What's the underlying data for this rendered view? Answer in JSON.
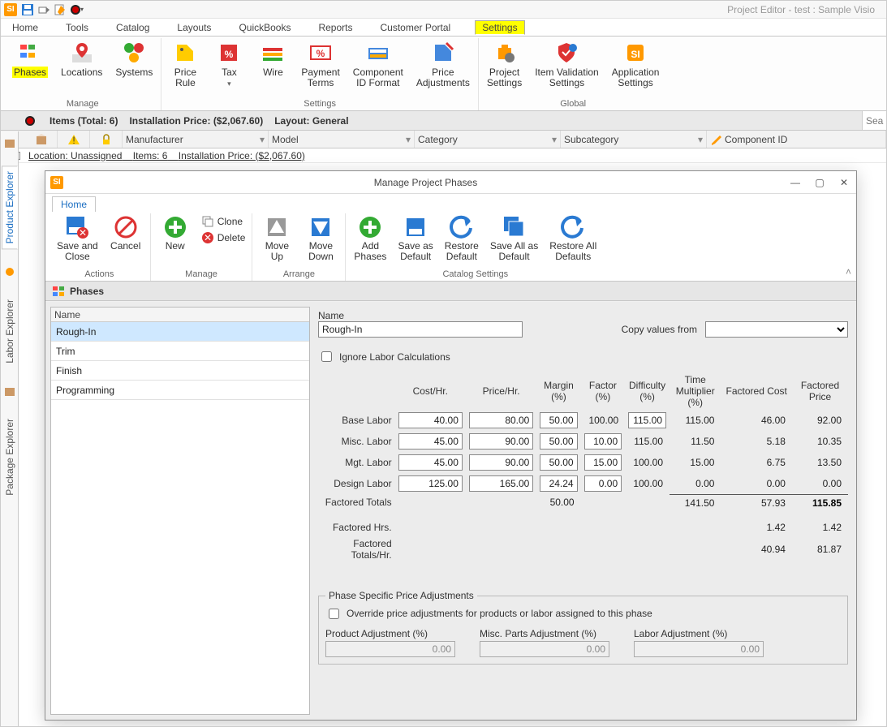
{
  "app_title": "Project Editor - test : Sample Visio",
  "menu_tabs": [
    "Home",
    "Tools",
    "Catalog",
    "Layouts",
    "QuickBooks",
    "Reports",
    "Customer Portal",
    "Settings"
  ],
  "active_menu_tab": "Settings",
  "ribbon": {
    "manage": {
      "label": "Manage",
      "phases": "Phases",
      "locations": "Locations",
      "systems": "Systems"
    },
    "settings": {
      "label": "Settings",
      "price_rule": "Price\nRule",
      "tax": "Tax",
      "wire": "Wire",
      "payment_terms": "Payment\nTerms",
      "component_id": "Component\nID Format",
      "price_adj": "Price\nAdjustments"
    },
    "global": {
      "label": "Global",
      "project_settings": "Project\nSettings",
      "item_validation": "Item Validation\nSettings",
      "app_settings": "Application\nSettings"
    }
  },
  "items_bar": {
    "items_total": "Items (Total: 6)",
    "install_price": "Installation Price: ($2,067.60)",
    "layout": "Layout: General",
    "search_placeholder": "Sea"
  },
  "columns": {
    "manufacturer": "Manufacturer",
    "model": "Model",
    "category": "Category",
    "subcategory": "Subcategory",
    "component_id": "Component ID"
  },
  "location_row": {
    "expand": "-",
    "location": "Location: Unassigned",
    "items": "Items: 6",
    "install": "Installation Price: ($2,067.60)"
  },
  "rails": {
    "product": "Product Explorer",
    "labor": "Labor Explorer",
    "package": "Package Explorer"
  },
  "dialog": {
    "title": "Manage Project Phases",
    "home_tab": "Home",
    "groups": {
      "actions": {
        "label": "Actions",
        "save_close": "Save and\nClose",
        "cancel": "Cancel"
      },
      "manage": {
        "label": "Manage",
        "new": "New",
        "clone": "Clone",
        "delete": "Delete"
      },
      "arrange": {
        "label": "Arrange",
        "move_up": "Move\nUp",
        "move_down": "Move\nDown"
      },
      "catalog": {
        "label": "Catalog Settings",
        "add_phases": "Add\nPhases",
        "save_default": "Save as\nDefault",
        "restore_default": "Restore\nDefault",
        "save_all_default": "Save All as\nDefault",
        "restore_all": "Restore All\nDefaults"
      }
    },
    "phases_header": "Phases",
    "name_col": "Name",
    "phases_list": [
      "Rough-In",
      "Trim",
      "Finish",
      "Programming"
    ],
    "selected_phase": "Rough-In",
    "detail": {
      "name_label": "Name",
      "name_value": "Rough-In",
      "copy_label": "Copy values from",
      "ignore_label": "Ignore Labor Calculations",
      "headers": {
        "cost": "Cost/Hr.",
        "price": "Price/Hr.",
        "margin": "Margin\n(%)",
        "factor": "Factor\n(%)",
        "difficulty": "Difficulty\n(%)",
        "time_mult": "Time\nMultiplier\n(%)",
        "fcost": "Factored Cost",
        "fprice": "Factored\nPrice"
      },
      "rows": [
        {
          "label": "Base Labor",
          "cost": "40.00",
          "price": "80.00",
          "margin": "50.00",
          "factor": "100.00",
          "difficulty": "115.00",
          "time_mult": "115.00",
          "fcost": "46.00",
          "fprice": "92.00",
          "factor_edit": false,
          "diff_edit": true
        },
        {
          "label": "Misc. Labor",
          "cost": "45.00",
          "price": "90.00",
          "margin": "50.00",
          "factor": "10.00",
          "difficulty": "115.00",
          "time_mult": "11.50",
          "fcost": "5.18",
          "fprice": "10.35",
          "factor_edit": true,
          "diff_edit": false
        },
        {
          "label": "Mgt. Labor",
          "cost": "45.00",
          "price": "90.00",
          "margin": "50.00",
          "factor": "15.00",
          "difficulty": "100.00",
          "time_mult": "15.00",
          "fcost": "6.75",
          "fprice": "13.50",
          "factor_edit": true,
          "diff_edit": false
        },
        {
          "label": "Design Labor",
          "cost": "125.00",
          "price": "165.00",
          "margin": "24.24",
          "factor": "0.00",
          "difficulty": "100.00",
          "time_mult": "0.00",
          "fcost": "0.00",
          "fprice": "0.00",
          "factor_edit": true,
          "diff_edit": false
        }
      ],
      "totals": {
        "label": "Factored Totals",
        "margin": "50.00",
        "time_mult": "141.50",
        "fcost": "57.93",
        "fprice": "115.85"
      },
      "fhrs": {
        "label": "Factored Hrs.",
        "fcost": "1.42",
        "fprice": "1.42"
      },
      "ftotals_hr": {
        "label": "Factored\nTotals/Hr.",
        "fcost": "40.94",
        "fprice": "81.87"
      },
      "adjustments": {
        "title": "Phase Specific Price Adjustments",
        "override": "Override price adjustments for products or labor assigned to this phase",
        "product": "Product Adjustment (%)",
        "product_val": "0.00",
        "misc": "Misc. Parts Adjustment (%)",
        "misc_val": "0.00",
        "labor": "Labor Adjustment (%)",
        "labor_val": "0.00"
      }
    }
  }
}
